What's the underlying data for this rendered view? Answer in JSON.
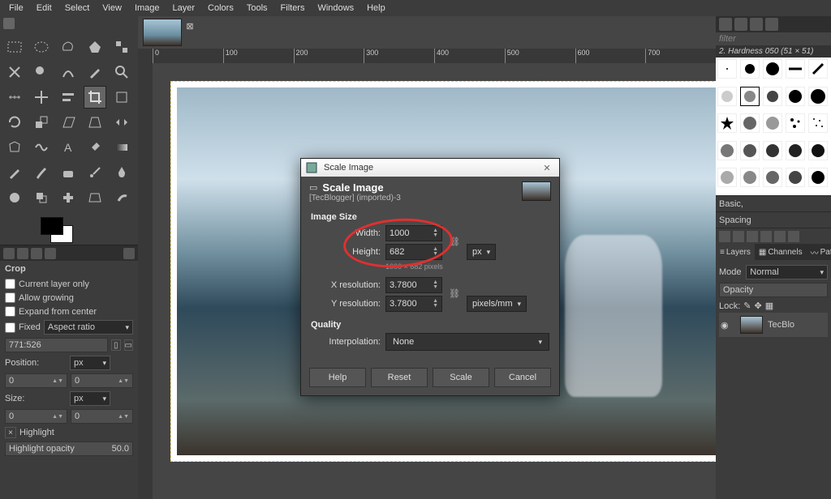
{
  "menubar": [
    "File",
    "Edit",
    "Select",
    "View",
    "Image",
    "Layer",
    "Colors",
    "Tools",
    "Filters",
    "Windows",
    "Help"
  ],
  "tool_options": {
    "title": "Crop",
    "current_layer_only": "Current layer only",
    "allow_growing": "Allow growing",
    "expand_from_center": "Expand from center",
    "fixed": "Fixed",
    "aspect_ratio": "Aspect ratio",
    "ratio_value": "771:526",
    "position": "Position:",
    "position_unit": "px",
    "pos_x": "0",
    "pos_y": "0",
    "size": "Size:",
    "size_unit": "px",
    "size_w": "0",
    "size_h": "0",
    "highlight": "Highlight",
    "highlight_opacity_label": "Highlight opacity",
    "highlight_opacity_value": "50.0"
  },
  "ruler_ticks": [
    "0",
    "100",
    "200",
    "300",
    "400",
    "500",
    "600",
    "700"
  ],
  "right_panel": {
    "filter_placeholder": "filter",
    "brush_name": "2. Hardness 050 (51 × 51)",
    "basic": "Basic,",
    "spacing": "Spacing",
    "layers_tab": "Layers",
    "channels_tab": "Channels",
    "paths_tab": "Path",
    "mode": "Mode",
    "mode_value": "Normal",
    "opacity": "Opacity",
    "lock": "Lock:",
    "layer_name": "TecBlo"
  },
  "dialog": {
    "window_title": "Scale Image",
    "title": "Scale Image",
    "subtitle": "[TecBlogger] (imported)-3",
    "image_size": "Image Size",
    "width_label": "Width:",
    "height_label": "Height:",
    "width_value": "1000",
    "height_value": "682",
    "note": "1000 × 682 pixels",
    "xres_label": "X resolution:",
    "yres_label": "Y resolution:",
    "xres_value": "3.7800",
    "yres_value": "3.7800",
    "size_unit": "px",
    "res_unit": "pixels/mm",
    "quality": "Quality",
    "interpolation_label": "Interpolation:",
    "interpolation_value": "None",
    "btn_help": "Help",
    "btn_reset": "Reset",
    "btn_scale": "Scale",
    "btn_cancel": "Cancel"
  }
}
